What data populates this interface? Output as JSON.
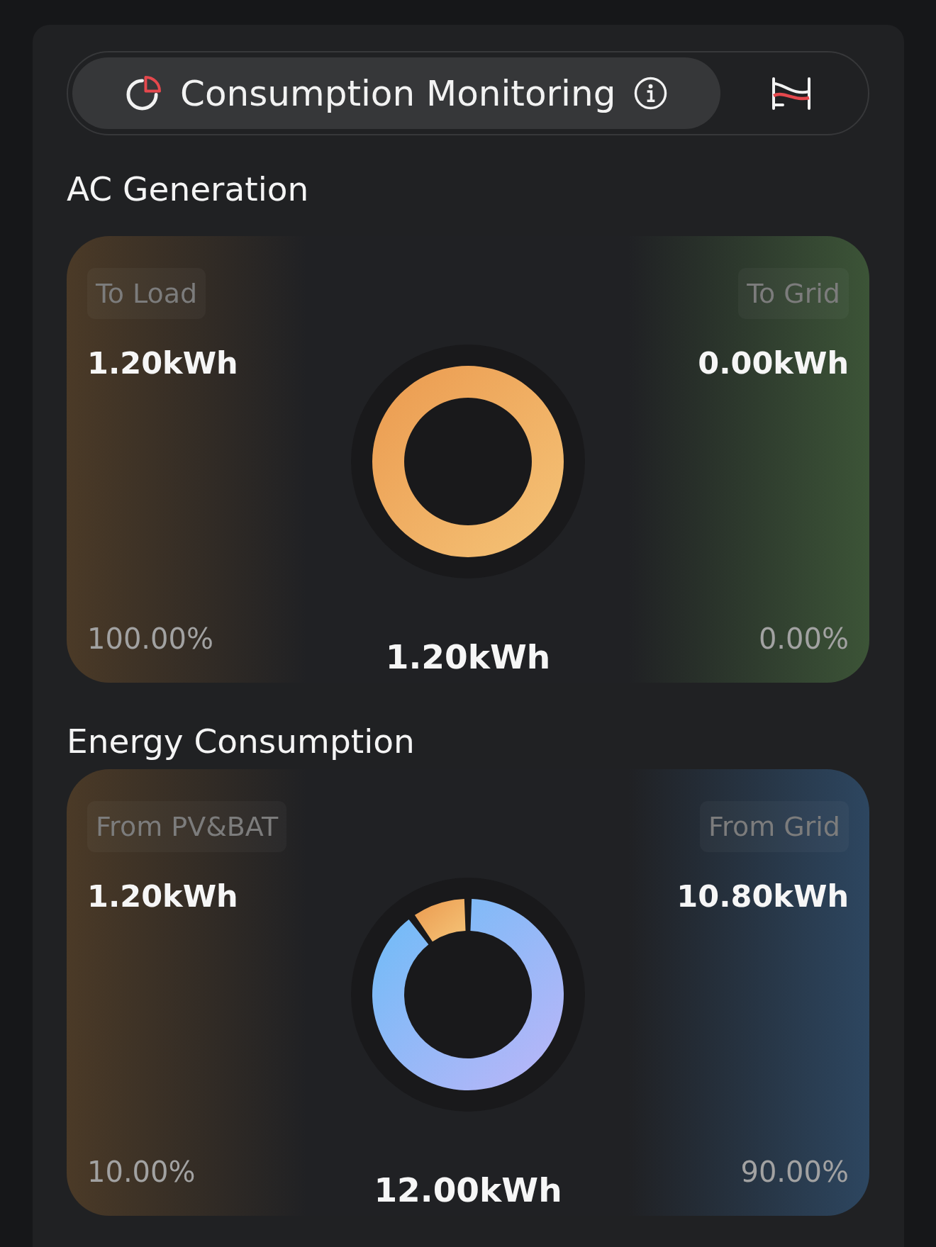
{
  "tabs": [
    {
      "kind": "consumption",
      "label": "Consumption Monitoring",
      "info": true,
      "selected": true
    },
    {
      "kind": "flag",
      "info": false,
      "selected": false
    }
  ],
  "sections": [
    {
      "title": "AC Generation",
      "sides": [
        {
          "label": "To Load",
          "value": "1.20kWh",
          "percent": "100.00%",
          "color": "#4b3a27"
        },
        {
          "label": "To Grid",
          "value": "0.00kWh",
          "percent": "0.00%",
          "color": "#3c5437"
        }
      ],
      "total": "1.20kWh",
      "chart_data": {
        "type": "donut",
        "values": [
          100,
          0
        ]
      }
    },
    {
      "title": "Energy Consumption",
      "sides": [
        {
          "label": "From PV&BAT",
          "value": "1.20kWh",
          "percent": "10.00%",
          "color": "#4b3a27"
        },
        {
          "label": "From Grid",
          "value": "10.80kWh",
          "percent": "90.00%",
          "color": "#2d4660"
        }
      ],
      "total": "12.00kWh",
      "chart_data": {
        "type": "donut",
        "values": [
          10,
          90
        ]
      }
    }
  ]
}
